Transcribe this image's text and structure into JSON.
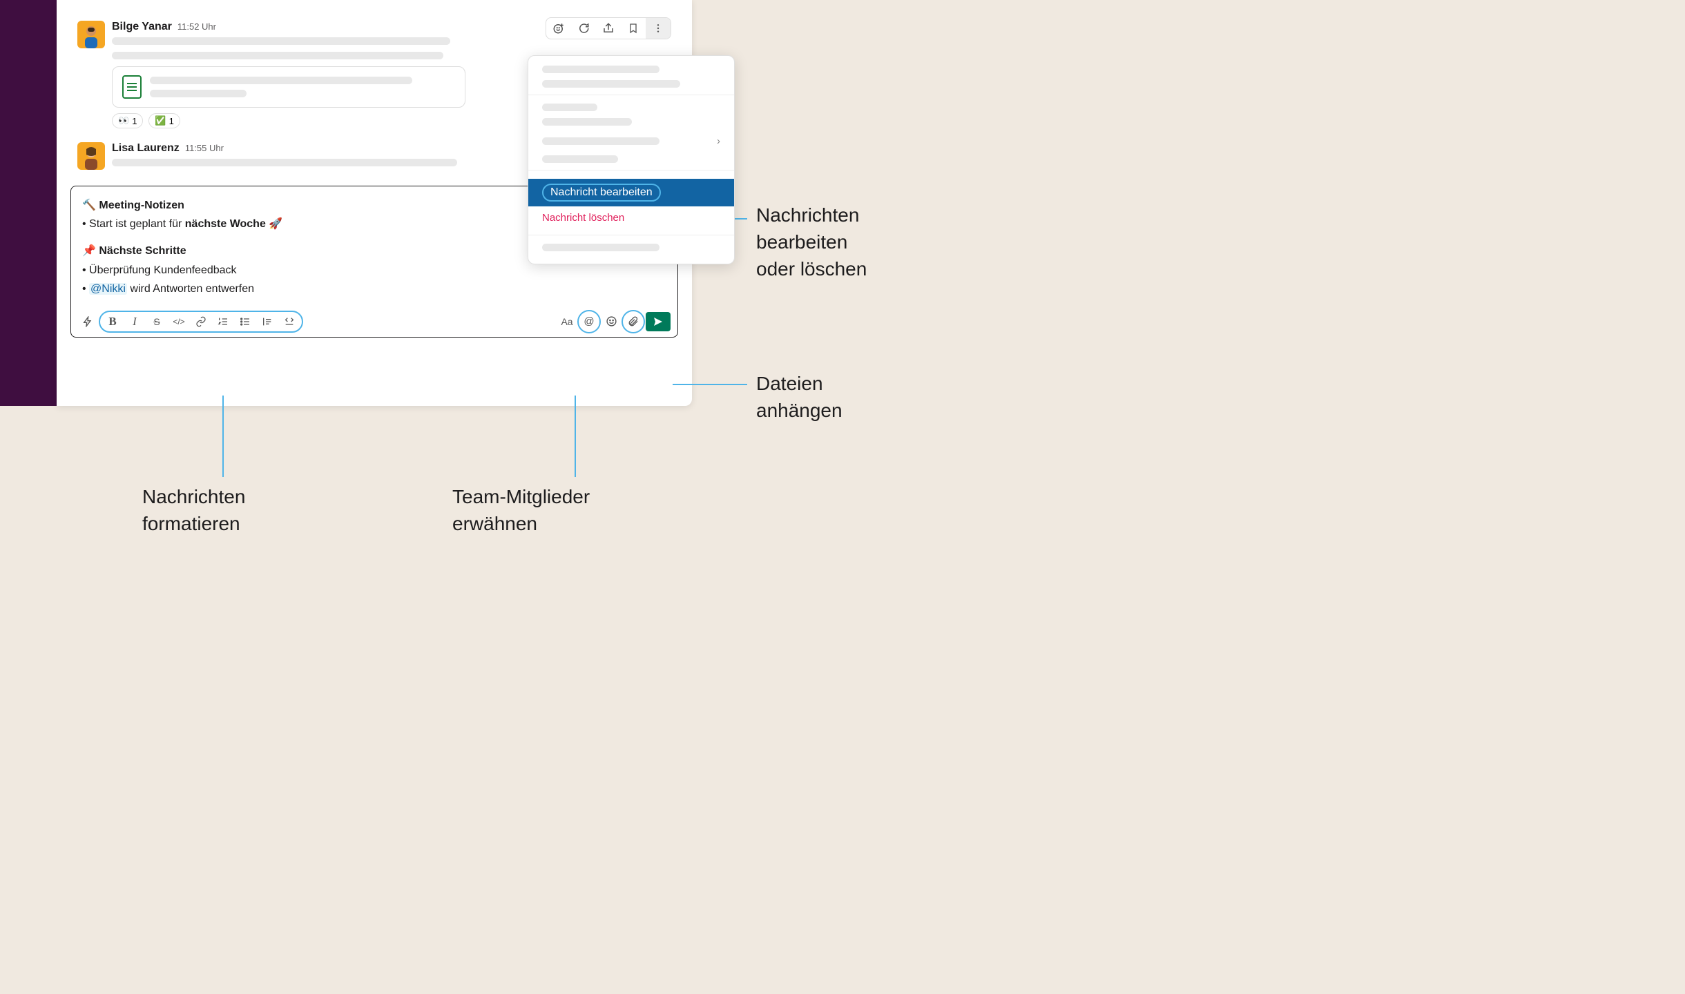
{
  "messages": [
    {
      "author": "Bilge Yanar",
      "time": "11:52 Uhr",
      "avatar_bg": "#f5a623",
      "reactions": [
        {
          "emoji": "👀",
          "count": "1"
        },
        {
          "emoji": "✅",
          "count": "1"
        }
      ]
    },
    {
      "author": "Lisa Laurenz",
      "time": "11:55 Uhr",
      "avatar_bg": "#f5a623"
    }
  ],
  "dropdown": {
    "edit": "Nachricht bearbeiten",
    "delete": "Nachricht löschen"
  },
  "composer": {
    "line1_emoji": "🔨",
    "line1_title": "Meeting-Notizen",
    "line2_prefix": "• Start ist geplant für ",
    "line2_bold": "nächste Woche",
    "line2_emoji": "🚀",
    "line3_emoji": "📌",
    "line3_title": "Nächste Schritte",
    "line4": "• Überprüfung Kundenfeedback",
    "line5_prefix": "• ",
    "line5_mention": "@Nikki",
    "line5_suffix": " wird Antworten entwerfen"
  },
  "callouts": {
    "edit_delete": "Nachrichten bearbeiten oder löschen",
    "attach": "Dateien anhängen",
    "format": "Nachrichten formatieren",
    "mention": "Team-Mitglieder erwähnen"
  }
}
